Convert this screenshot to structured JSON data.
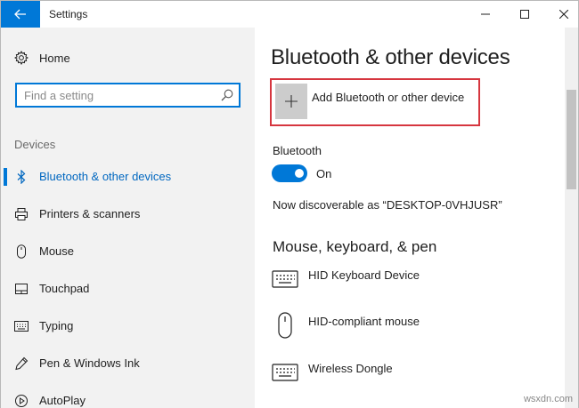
{
  "window": {
    "title": "Settings"
  },
  "sidebar": {
    "home_label": "Home",
    "search_placeholder": "Find a setting",
    "section_label": "Devices",
    "items": [
      {
        "label": "Bluetooth & other devices",
        "icon": "bluetooth-icon",
        "active": true
      },
      {
        "label": "Printers & scanners",
        "icon": "printer-icon",
        "active": false
      },
      {
        "label": "Mouse",
        "icon": "mouse-icon",
        "active": false
      },
      {
        "label": "Touchpad",
        "icon": "touchpad-icon",
        "active": false
      },
      {
        "label": "Typing",
        "icon": "keyboard-icon",
        "active": false
      },
      {
        "label": "Pen & Windows Ink",
        "icon": "pen-icon",
        "active": false
      },
      {
        "label": "AutoPlay",
        "icon": "autoplay-icon",
        "active": false
      }
    ]
  },
  "main": {
    "title": "Bluetooth & other devices",
    "add_device_label": "Add Bluetooth or other device",
    "bluetooth_label": "Bluetooth",
    "bluetooth_state": "On",
    "discoverable_text": "Now discoverable as “DESKTOP-0VHJUSR”",
    "section_title": "Mouse, keyboard, & pen",
    "devices": [
      {
        "label": "HID Keyboard Device",
        "icon": "keyboard-icon"
      },
      {
        "label": "HID-compliant mouse",
        "icon": "mouse-icon"
      },
      {
        "label": "Wireless Dongle",
        "icon": "keyboard-icon"
      }
    ]
  },
  "watermark": "wsxdn.com",
  "colors": {
    "accent": "#0078d7",
    "highlight_border": "#d6363f",
    "sidebar_bg": "#f2f2f2"
  }
}
